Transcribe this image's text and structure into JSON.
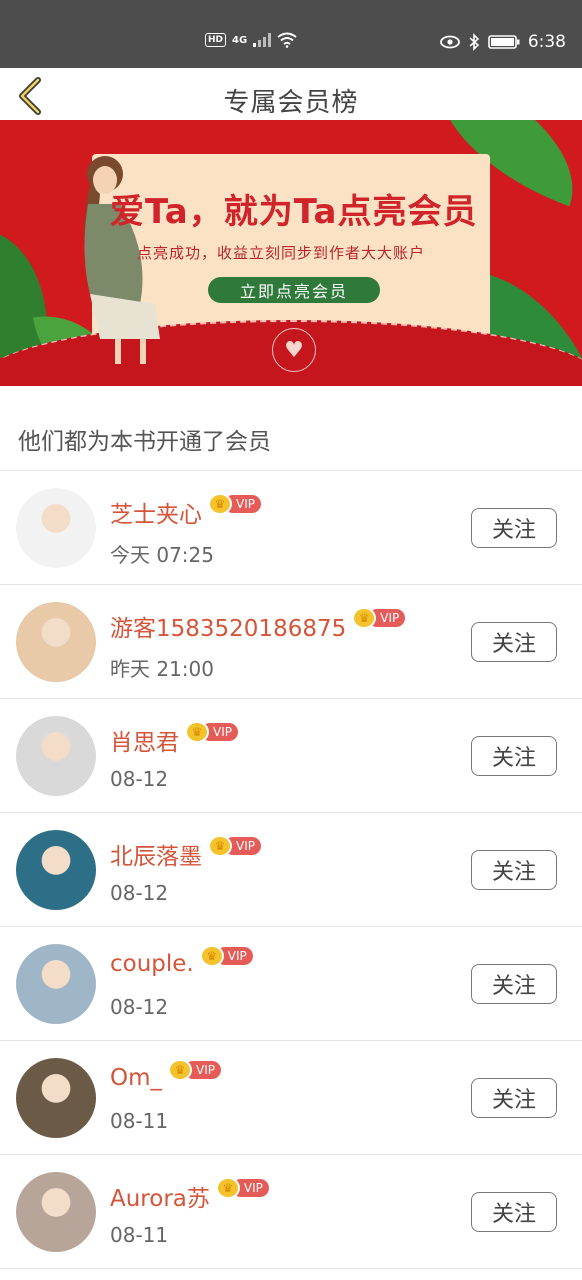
{
  "status_bar": {
    "network": "4G",
    "hd": "HD",
    "time": "6:38"
  },
  "header": {
    "title": "专属会员榜",
    "back_icon": "chevron-left-icon"
  },
  "banner": {
    "title": "爱Ta，就为Ta点亮会员",
    "subtitle": "点亮成功，收益立刻同步到作者大大账户",
    "button_label": "立即点亮会员"
  },
  "section": {
    "title": "他们都为本书开通了会员"
  },
  "members": [
    {
      "name": "芝士夹心",
      "time": "今天 07:25",
      "vip": "VIP",
      "follow_label": "关注",
      "avatar_color": "#f2f2f2"
    },
    {
      "name": "游客1583520186875",
      "time": "昨天 21:00",
      "vip": "VIP",
      "follow_label": "关注",
      "avatar_color": "#e8c9a8"
    },
    {
      "name": "肖思君",
      "time": "08-12",
      "vip": "VIP",
      "follow_label": "关注",
      "avatar_color": "#d9d9d9"
    },
    {
      "name": "北辰落墨",
      "time": "08-12",
      "vip": "VIP",
      "follow_label": "关注",
      "avatar_color": "#2d6f86"
    },
    {
      "name": "couple.",
      "time": "08-12",
      "vip": "VIP",
      "follow_label": "关注",
      "avatar_color": "#9fb6c9"
    },
    {
      "name": "Om_",
      "time": "08-11",
      "vip": "VIP",
      "follow_label": "关注",
      "avatar_color": "#6b5a45"
    },
    {
      "name": "Aurora苏",
      "time": "08-11",
      "vip": "VIP",
      "follow_label": "关注",
      "avatar_color": "#b7a59a"
    }
  ],
  "colors": {
    "accent_name": "#d4553a",
    "vip_tag": "#e45b57",
    "banner_red": "#d01a1e",
    "banner_button": "#2f7a3a"
  }
}
